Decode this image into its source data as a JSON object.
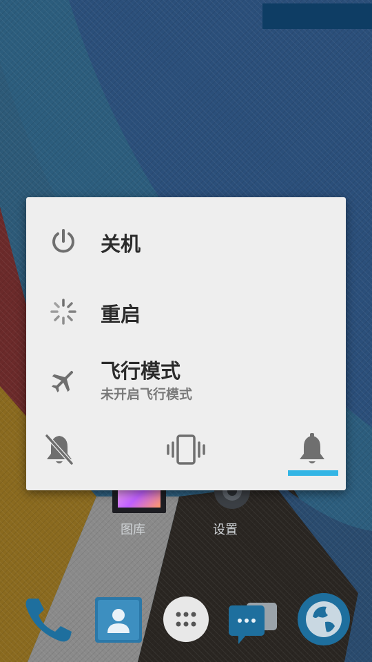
{
  "colors": {
    "dialog_background": "#eeeeee",
    "accent": "#33b5e5",
    "icon_gray": "#6f6f6f",
    "primary_text": "#2b2b2b",
    "secondary_text": "#7a7a7a"
  },
  "home_screen": {
    "apps": [
      {
        "label": "图库",
        "icon": "gallery-icon"
      },
      {
        "label": "设置",
        "icon": "gear-icon"
      }
    ],
    "dock": [
      {
        "icon": "phone-icon"
      },
      {
        "icon": "contacts-icon"
      },
      {
        "icon": "app-drawer-icon"
      },
      {
        "icon": "messages-icon"
      },
      {
        "icon": "browser-icon"
      }
    ]
  },
  "power_menu": {
    "items": [
      {
        "icon": "power-icon",
        "title": "关机"
      },
      {
        "icon": "restart-icon",
        "title": "重启"
      },
      {
        "icon": "airplane-icon",
        "title": "飞行模式",
        "subtitle": "未开启飞行模式"
      }
    ],
    "sound_modes": [
      {
        "icon": "bell-off-icon",
        "selected": false
      },
      {
        "icon": "vibrate-icon",
        "selected": false
      },
      {
        "icon": "bell-icon",
        "selected": true
      }
    ]
  }
}
